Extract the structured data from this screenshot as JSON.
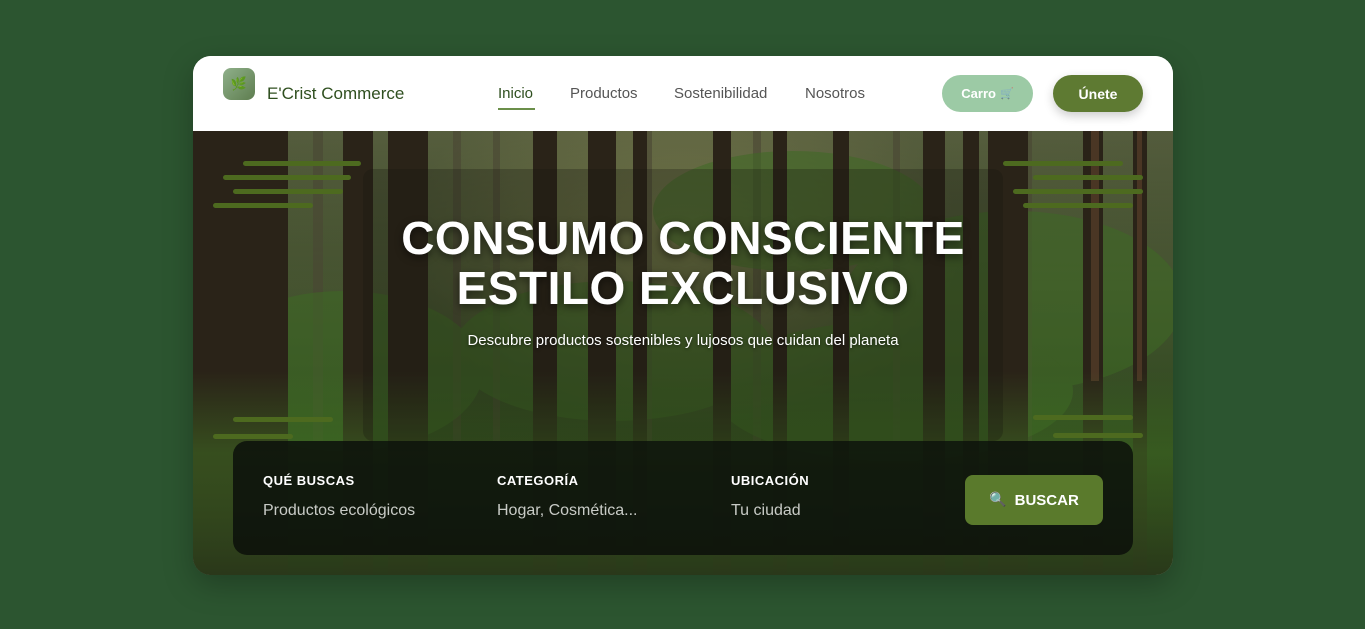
{
  "brand": {
    "name": "E'Crist Commerce",
    "logo_icon": "leaf-icon"
  },
  "nav": {
    "links": [
      {
        "label": "Inicio",
        "active": true
      },
      {
        "label": "Productos",
        "active": false
      },
      {
        "label": "Sostenibilidad",
        "active": false
      },
      {
        "label": "Nosotros",
        "active": false
      }
    ],
    "cart_label": "Carro",
    "cart_icon": "🛒",
    "join_label": "Únete"
  },
  "hero": {
    "title_line1": "CONSUMO CONSCIENTE",
    "title_line2": "ESTILO EXCLUSIVO",
    "subtitle": "Descubre productos sostenibles y lujosos que cuidan del planeta"
  },
  "search": {
    "fields": [
      {
        "label": "QUÉ BUSCAS",
        "value": "Productos ecológicos"
      },
      {
        "label": "CATEGORÍA",
        "value": "Hogar, Cosmética..."
      },
      {
        "label": "UBICACIÓN",
        "value": "Tu ciudad"
      }
    ],
    "button_label": "BUSCAR",
    "button_icon": "🔍"
  },
  "colors": {
    "page_background": "#2c5530",
    "brand_text": "#2f4f1f",
    "cart_button": "#9ccaa5",
    "join_button": "#5e7a32",
    "search_button": "#5a7a2c",
    "accent_underline": "#6b8f4a"
  }
}
